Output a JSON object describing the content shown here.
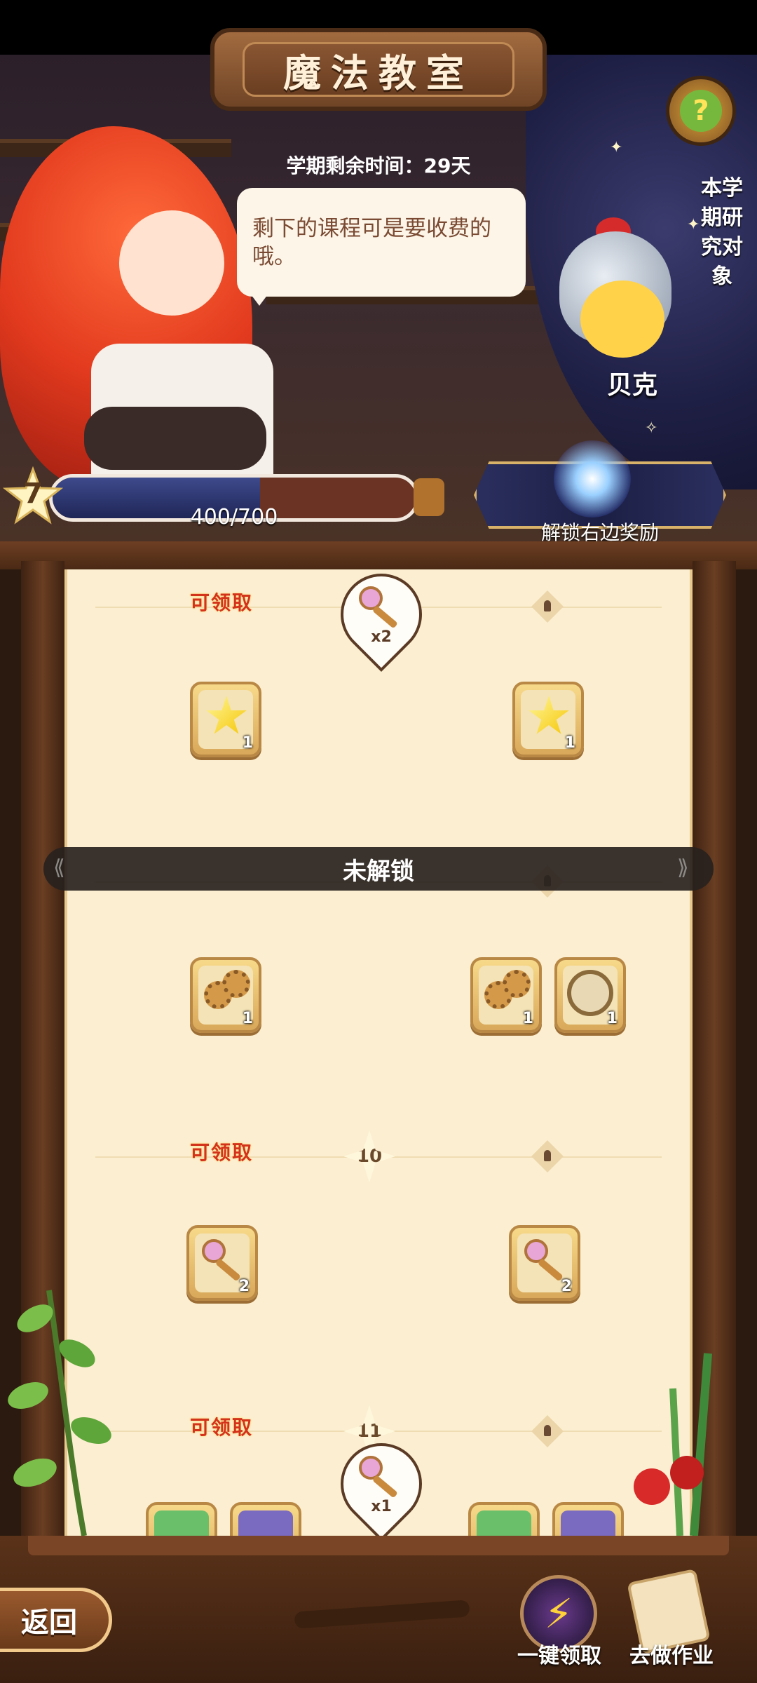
{
  "header": {
    "title": "魔法教室",
    "semester_label": "学期剩余时间：29天",
    "help_icon": "question-mark-icon"
  },
  "dialogue": {
    "speech": "剩下的课程可是要收费的哦。"
  },
  "research_target": {
    "label": "本学期研究对象",
    "npc_name": "贝克"
  },
  "level": {
    "current_level": "7",
    "progress_text": "400/700",
    "progress_fraction": 0.571
  },
  "unlock_banner": {
    "label": "解锁右边奖励"
  },
  "reward_track": {
    "claim_label": "可领取",
    "locked_label": "未解锁",
    "rows": [
      {
        "level": "",
        "claimable": true,
        "left_items": [
          {
            "icon": "star-shard-icon",
            "qty": "1"
          }
        ],
        "right_items": [
          {
            "icon": "star-shard-icon",
            "qty": "1"
          }
        ],
        "pin": {
          "icon": "magic-key-icon",
          "multiplier": "x2"
        }
      },
      {
        "level": "",
        "claimable": false,
        "left_items": [
          {
            "icon": "gears-icon",
            "qty": "1"
          }
        ],
        "right_items": [
          {
            "icon": "gears-icon",
            "qty": "1"
          },
          {
            "icon": "compass-icon",
            "qty": "1"
          }
        ]
      },
      {
        "level": "10",
        "claimable": true,
        "left_items": [
          {
            "icon": "magic-key-icon",
            "qty": "2"
          }
        ],
        "right_items": [
          {
            "icon": "magic-key-icon",
            "qty": "2"
          }
        ]
      },
      {
        "level": "11",
        "claimable": true,
        "pin": {
          "icon": "magic-key-icon",
          "multiplier": "x1"
        }
      }
    ]
  },
  "bottom_bar": {
    "back_label": "返回",
    "claim_all_label": "一键领取",
    "homework_label": "去做作业"
  },
  "colors": {
    "claim_text": "#d3321b",
    "panel_bg": "#fcefd1",
    "wood": "#6e3f23"
  }
}
